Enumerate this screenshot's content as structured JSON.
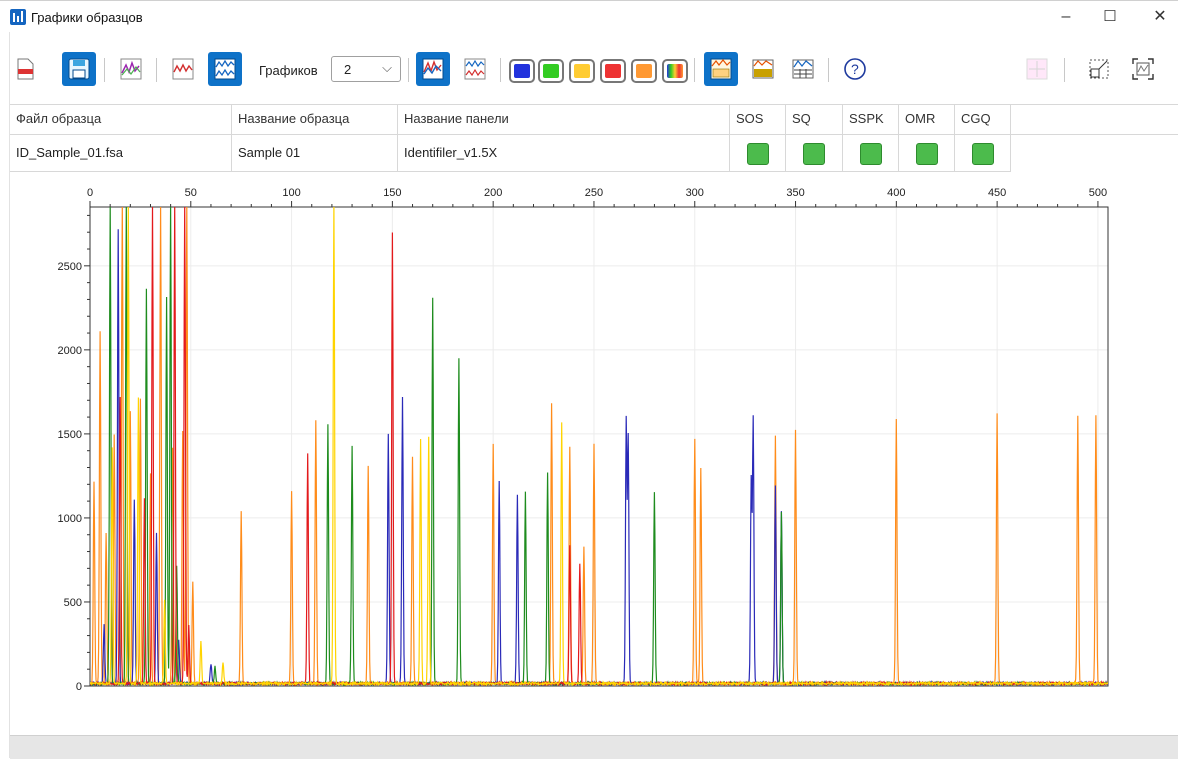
{
  "window": {
    "title": "Графики образцов",
    "minimize": "–",
    "maximize": "☐",
    "close": "✕"
  },
  "toolbar": {
    "plots_label": "Графиков",
    "plots_value": "2",
    "plots_arrow": "⌵",
    "help": "?",
    "color_buttons": [
      {
        "name": "blue",
        "color": "#2233dd"
      },
      {
        "name": "green",
        "color": "#33cc22"
      },
      {
        "name": "yellow",
        "color": "#ffcc33"
      },
      {
        "name": "red",
        "color": "#ee3333"
      },
      {
        "name": "orange",
        "color": "#ff9933"
      },
      {
        "name": "all",
        "color": "rainbow"
      }
    ]
  },
  "table": {
    "columns": [
      "Файл образца",
      "Название образца",
      "Название панели",
      "SOS",
      "SQ",
      "SSPK",
      "OMR",
      "CGQ"
    ],
    "rows": [
      {
        "file": "ID_Sample_01.fsa",
        "sample": "Sample 01",
        "panel": "Identifiler_v1.5X",
        "flags": [
          "ok",
          "ok",
          "ok",
          "ok",
          "ok"
        ]
      }
    ],
    "status_color": "#4cbb4c"
  },
  "chart_data": {
    "type": "line",
    "x_ticks": [
      0,
      50,
      100,
      150,
      200,
      250,
      300,
      350,
      400,
      450,
      500
    ],
    "y_ticks": [
      0,
      500,
      1000,
      1500,
      2000,
      2500
    ],
    "xlim": [
      0,
      505
    ],
    "ylim": [
      0,
      2850
    ],
    "grid": true,
    "series": [
      {
        "color": "#ff8c1a",
        "peaks": [
          [
            75,
            1020
          ],
          [
            100,
            1150
          ],
          [
            112,
            1570
          ],
          [
            138,
            1290
          ],
          [
            160,
            1350
          ],
          [
            200,
            1420
          ],
          [
            229,
            1670
          ],
          [
            238,
            1410
          ],
          [
            245,
            820
          ],
          [
            250,
            1420
          ],
          [
            300,
            1450
          ],
          [
            303,
            1280
          ],
          [
            340,
            1480
          ],
          [
            350,
            1510
          ],
          [
            400,
            1570
          ],
          [
            450,
            1600
          ],
          [
            490,
            1590
          ],
          [
            499,
            1600
          ]
        ]
      },
      {
        "color": "#2a2ab8",
        "peaks": [
          [
            148,
            1490
          ],
          [
            155,
            1700
          ],
          [
            203,
            1210
          ],
          [
            212,
            1130
          ],
          [
            266,
            1570
          ],
          [
            267,
            1470
          ],
          [
            328,
            1220
          ],
          [
            329,
            1580
          ],
          [
            343,
            1020
          ],
          [
            340,
            1180
          ]
        ]
      },
      {
        "color": "#1e8c1e",
        "peaks": [
          [
            118,
            1540
          ],
          [
            130,
            1410
          ],
          [
            170,
            2290
          ],
          [
            183,
            1930
          ],
          [
            216,
            1140
          ],
          [
            227,
            1260
          ],
          [
            280,
            1140
          ],
          [
            343,
            1020
          ]
        ]
      },
      {
        "color": "#e31a1c",
        "peaks": [
          [
            108,
            1370
          ],
          [
            150,
            2680
          ],
          [
            238,
            820
          ],
          [
            243,
            710
          ]
        ]
      },
      {
        "color": "#ffd400",
        "peaks": [
          [
            121,
            2850
          ],
          [
            164,
            1450
          ],
          [
            168,
            1470
          ],
          [
            234,
            1560
          ]
        ]
      }
    ]
  }
}
